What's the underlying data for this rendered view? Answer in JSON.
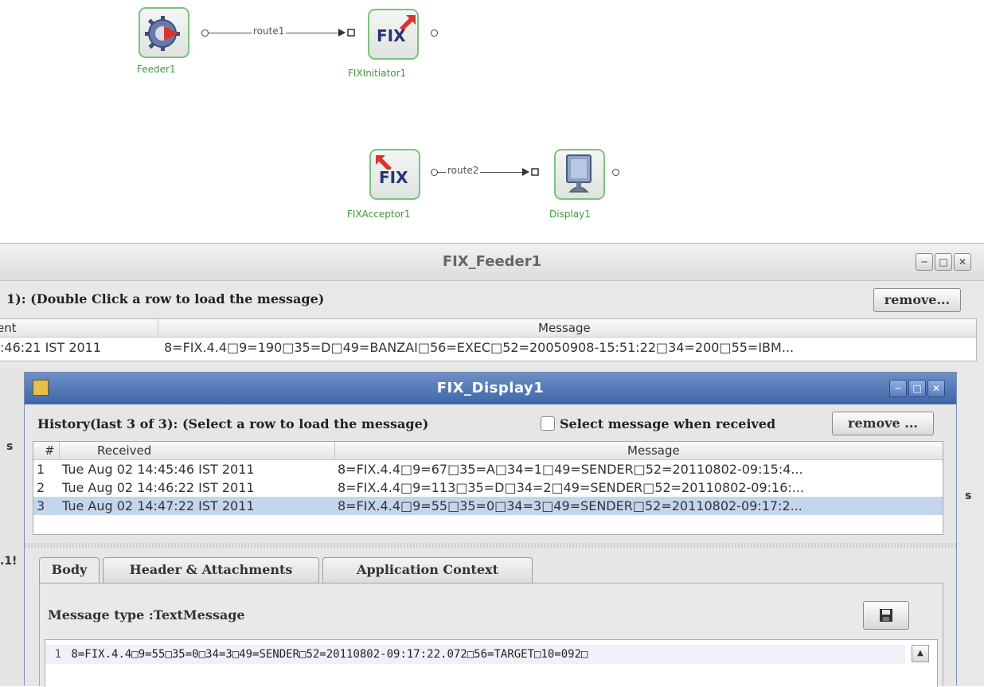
{
  "flow": {
    "nodes": [
      {
        "id": "feeder1",
        "label": "Feeder1"
      },
      {
        "id": "fixinitiator1",
        "label": "FIXInitiator1",
        "icon_text": "FIX"
      },
      {
        "id": "fixacceptor1",
        "label": "FIXAcceptor1",
        "icon_text": "FIX"
      },
      {
        "id": "display1",
        "label": "Display1"
      }
    ],
    "routes": [
      {
        "label": "route1"
      },
      {
        "label": "route2"
      }
    ]
  },
  "feeder_window": {
    "title": "FIX_Feeder1",
    "hint": "1):   (Double Click a row to load the message)",
    "remove_label": "remove...",
    "columns": {
      "sent": "ent",
      "message": "Message"
    },
    "row": {
      "sent": ":46:21 IST 2011",
      "message": "8=FIX.4.4□9=190□35=D□49=BANZAI□56=EXEC□52=20050908-15:51:22□34=200□55=IBM..."
    },
    "side_labels": [
      "s",
      "s",
      ".1!"
    ]
  },
  "display_window": {
    "title": "FIX_Display1",
    "history_hint": "History(last 3 of 3):   (Select a row to load the message)",
    "select_when_received": "Select message when received",
    "remove_label": "remove ...",
    "columns": {
      "num": "#",
      "received": "Received",
      "message": "Message"
    },
    "rows": [
      {
        "num": "1",
        "received": "Tue Aug 02 14:45:46 IST 2011",
        "message": "8=FIX.4.4□9=67□35=A□34=1□49=SENDER□52=20110802-09:15:4..."
      },
      {
        "num": "2",
        "received": "Tue Aug 02 14:46:22 IST 2011",
        "message": "8=FIX.4.4□9=113□35=D□34=2□49=SENDER□52=20110802-09:16:..."
      },
      {
        "num": "3",
        "received": "Tue Aug 02 14:47:22 IST 2011",
        "message": "8=FIX.4.4□9=55□35=0□34=3□49=SENDER□52=20110802-09:17:2..."
      }
    ],
    "tabs": [
      "Body",
      "Header & Attachments",
      "Application Context"
    ],
    "message_type": "Message type :TextMessage",
    "editor_line_number": "1",
    "editor_text": "8=FIX.4.4□9=55□35=0□34=3□49=SENDER□52=20110802-09:17:22.072□56=TARGET□10=092□"
  },
  "colors": {
    "node_border": "#7cc27c",
    "node_label": "#3a9a3a",
    "fix_text": "#24357a",
    "fix_arrow": "#d9342b",
    "title_blue": "#4a6fb0",
    "selected_row": "#c4d6ec"
  },
  "icons": [
    "feeder-gear-icon",
    "fix-initiator-icon",
    "fix-acceptor-icon",
    "display-monitor-icon",
    "minimize-icon",
    "maximize-icon",
    "close-icon",
    "save-icon",
    "scroll-up-icon",
    "app-icon"
  ]
}
